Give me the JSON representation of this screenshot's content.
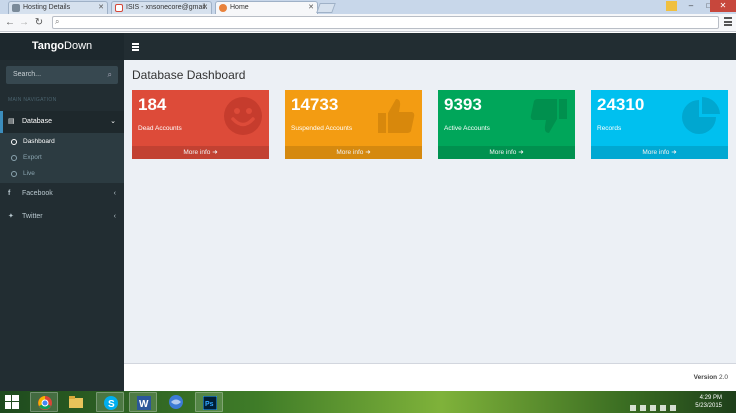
{
  "browser": {
    "tabs": [
      {
        "label": "Hosting Details",
        "favicon": "document-icon",
        "color": "#7a8a99"
      },
      {
        "label": "ISIS - xnsonecore@gmail.",
        "favicon": "gmail-icon",
        "color": "#d44638"
      },
      {
        "label": "Home",
        "favicon": "page-icon",
        "color": "#e8823c"
      }
    ],
    "url": ""
  },
  "app": {
    "brand_bold": "Tango",
    "brand_light": "Down",
    "search_placeholder": "Search...",
    "nav_header": "MAIN NAVIGATION",
    "menu": [
      {
        "label": "Database",
        "icon": "database-icon",
        "chevron": "⌄"
      },
      {
        "label": "Facebook",
        "icon": "facebook-icon",
        "chevron": "‹"
      },
      {
        "label": "Twitter",
        "icon": "twitter-icon",
        "chevron": "‹"
      }
    ],
    "submenu": [
      {
        "label": "Dashboard"
      },
      {
        "label": "Export"
      },
      {
        "label": "Live"
      }
    ]
  },
  "page": {
    "title": "Database Dashboard",
    "boxes": [
      {
        "value": "184",
        "label": "Dead Accounts",
        "more": "More info",
        "color": "#dd4b39",
        "icon": "smiley-icon"
      },
      {
        "value": "14733",
        "label": "Suspended Accounts",
        "more": "More info",
        "color": "#f39c12",
        "icon": "thumbs-up-icon"
      },
      {
        "value": "9393",
        "label": "Active Accounts",
        "more": "More info",
        "color": "#00a65a",
        "icon": "thumbs-down-icon"
      },
      {
        "value": "24310",
        "label": "Records",
        "more": "More info",
        "color": "#00c0ef",
        "icon": "pie-chart-icon"
      }
    ],
    "footer": {
      "version_label": "Version",
      "version_value": "2.0"
    }
  },
  "taskbar": {
    "time": "4:29 PM",
    "date": "5/23/2015",
    "apps": [
      "chrome-icon",
      "file-explorer-icon",
      "skype-icon",
      "word-icon",
      "browser-icon",
      "photoshop-icon"
    ]
  }
}
